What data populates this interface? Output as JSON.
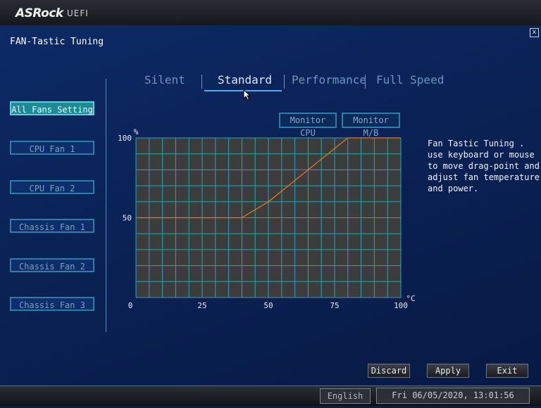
{
  "header": {
    "logo_text": "ASRock",
    "logo_sub": "UEFI"
  },
  "window": {
    "title": "FAN-Tastic Tuning",
    "close_glyph": "x"
  },
  "tabs": [
    {
      "label": "Silent",
      "active": false
    },
    {
      "label": "Standard",
      "active": true
    },
    {
      "label": "Performance",
      "active": false
    },
    {
      "label": "Full Speed",
      "active": false
    }
  ],
  "fans": [
    {
      "label": "All Fans Setting",
      "active": true
    },
    {
      "label": "CPU Fan 1",
      "active": false
    },
    {
      "label": "CPU Fan 2",
      "active": false
    },
    {
      "label": "Chassis Fan 1",
      "active": false
    },
    {
      "label": "Chassis Fan 2",
      "active": false
    },
    {
      "label": "Chassis Fan 3",
      "active": false
    }
  ],
  "monitor_buttons": {
    "cpu": "Monitor CPU",
    "mb": "Monitor M/B"
  },
  "help_text": "Fan Tastic Tuning . use keyboard or mouse to move drag-point and adjust fan temperature and power.",
  "footer": {
    "discard": "Discard",
    "apply": "Apply",
    "exit": "Exit"
  },
  "status": {
    "language": "English",
    "datetime": "Fri 06/05/2020, 13:01:56"
  },
  "colors": {
    "accent": "#5fd0d8",
    "curve": "#e8741e",
    "grid": "#2aa2b8",
    "plot_bg": "#3c3c3c"
  },
  "chart_data": {
    "type": "line",
    "xlabel": "°C",
    "ylabel": "%",
    "xlim": [
      0,
      100
    ],
    "ylim": [
      0,
      100
    ],
    "x_ticks": [
      0,
      25,
      50,
      75,
      100
    ],
    "y_ticks": [
      50,
      100
    ],
    "grid": true,
    "series": [
      {
        "x": [
          0,
          40,
          50,
          80,
          100
        ],
        "y": [
          50,
          50,
          60,
          100,
          100
        ]
      }
    ]
  }
}
